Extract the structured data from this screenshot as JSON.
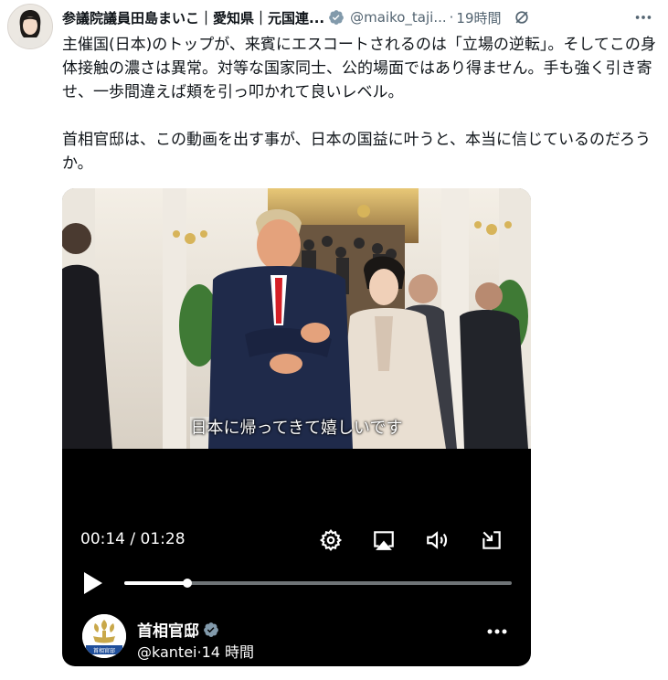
{
  "post": {
    "author_name": "参議院議員田島まいこ｜愛知県｜元国連...",
    "handle": "@maiko_taji...",
    "separator": "·",
    "time": "19時間",
    "text": "主催国(日本)のトップが、来賓にエスコートされるのは「立場の逆転」。そしてこの身体接触の濃さは異常。対等な国家同士、公的場面ではあり得ません。手も強く引き寄せ、一歩間違えば頬を引っ叩かれて良いレベル。\n\n首相官邸は、この動画を出す事が、日本の国益に叶うと、本当に信じているのだろうか。"
  },
  "video": {
    "subtitle": "日本に帰ってきて嬉しいです",
    "current_time": "00:14",
    "duration": "01:28",
    "time_separator": " / ",
    "progress_fraction": 0.163,
    "controls": [
      "settings-icon",
      "airplay-icon",
      "volume-icon",
      "pop-out-icon",
      "play-icon"
    ],
    "channel": {
      "name": "首相官邸",
      "handle": "@kantei",
      "separator": "·",
      "time": "14 時間",
      "logo_caption": "首相官邸"
    }
  },
  "colors": {
    "text": "#0f1419",
    "secondary": "#536471",
    "verified_badge": "#829aab",
    "video_bg": "#000000"
  }
}
